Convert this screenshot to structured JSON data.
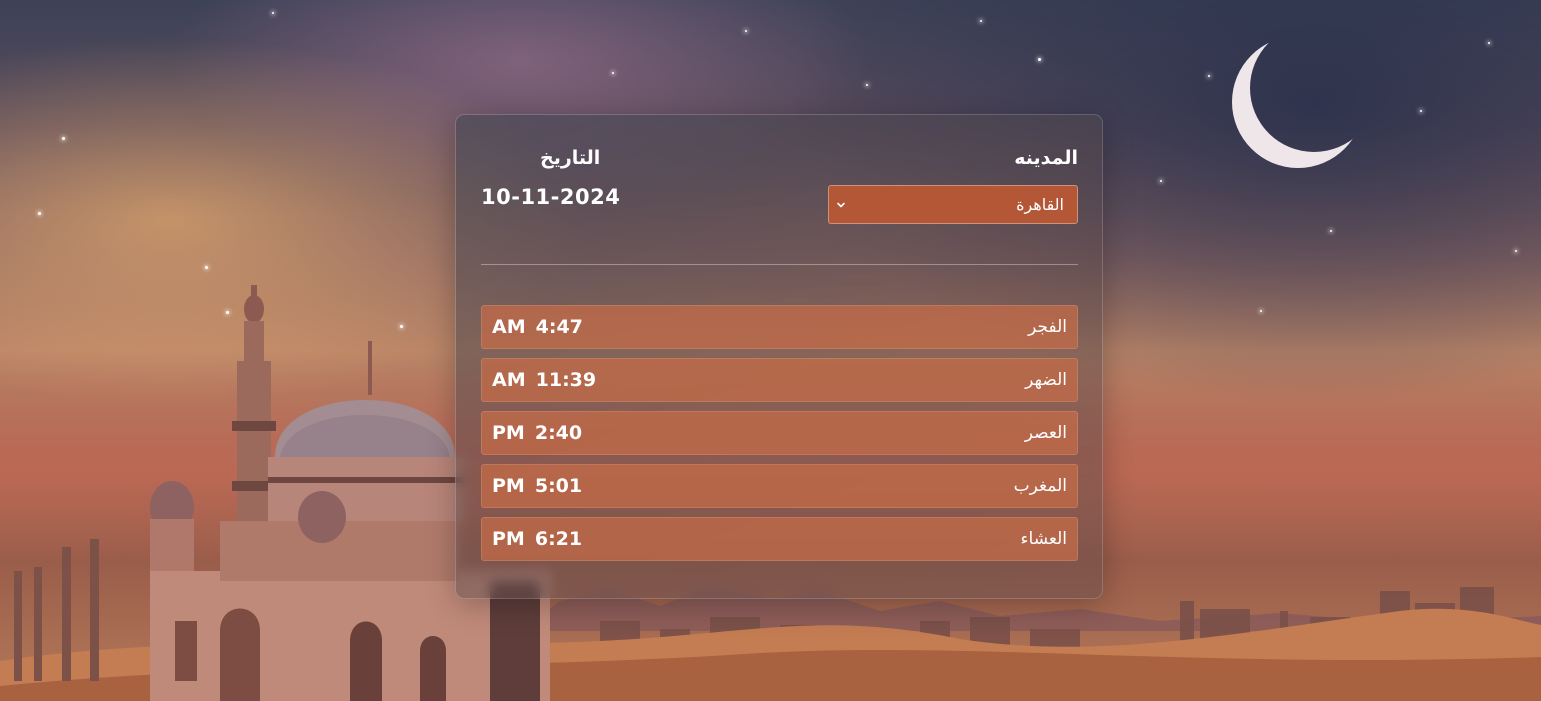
{
  "form": {
    "city_label": "المدينه",
    "city_selected": "القاهرة",
    "date_label": "التاريخ",
    "date_value": "10-11-2024"
  },
  "prayers": [
    {
      "name": "الفجر",
      "time": "4:47",
      "period": "AM"
    },
    {
      "name": "الضهر",
      "time": "11:39",
      "period": "AM"
    },
    {
      "name": "العصر",
      "time": "2:40",
      "period": "PM"
    },
    {
      "name": "المغرب",
      "time": "5:01",
      "period": "PM"
    },
    {
      "name": "العشاء",
      "time": "6:21",
      "period": "PM"
    }
  ],
  "colors": {
    "select_bg": "#b35736",
    "row_bg": "#c66c48"
  },
  "icons": {
    "select": "chevron-down-icon"
  }
}
